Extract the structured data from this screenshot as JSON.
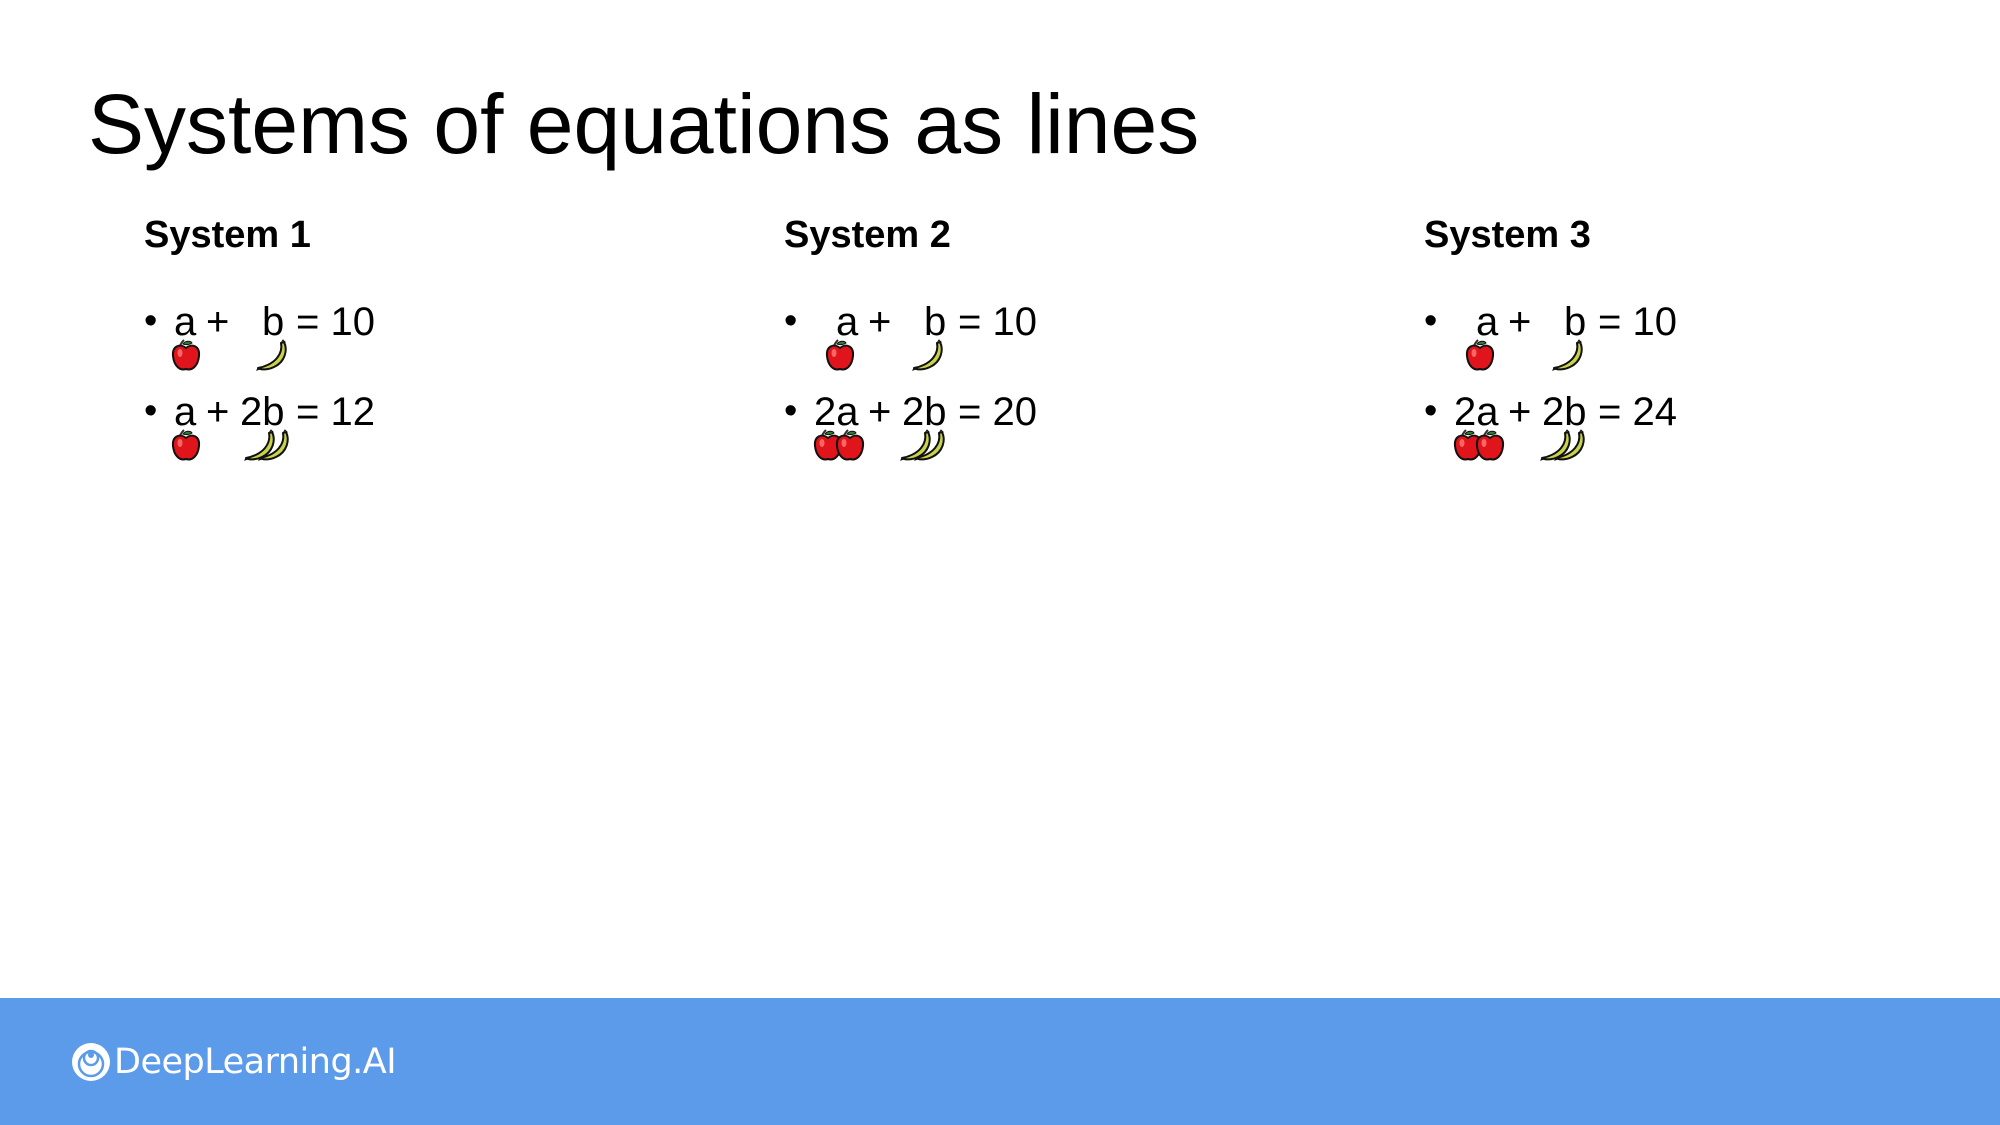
{
  "slide": {
    "title": "Systems of equations as lines"
  },
  "systems": [
    {
      "title": "System 1",
      "equations": [
        {
          "bullet": "•",
          "apple_coef": "",
          "plus": "+",
          "banana_coef": "",
          "rhs": "= 10",
          "apples": 1,
          "bananas": 1
        },
        {
          "bullet": "•",
          "apple_coef": "",
          "plus": "+",
          "banana_coef": "2",
          "rhs": "= 12",
          "apples": 1,
          "bananas": 2
        }
      ]
    },
    {
      "title": "System 2",
      "equations": [
        {
          "bullet": "•",
          "apple_coef": "",
          "plus": "+",
          "banana_coef": "",
          "rhs": "= 10",
          "apples": 1,
          "bananas": 1
        },
        {
          "bullet": "•",
          "apple_coef": "2",
          "plus": "+",
          "banana_coef": "2",
          "rhs": "= 20",
          "apples": 2,
          "bananas": 2
        }
      ]
    },
    {
      "title": "System 3",
      "equations": [
        {
          "bullet": "•",
          "apple_coef": "",
          "plus": "+",
          "banana_coef": "",
          "rhs": "= 10",
          "apples": 1,
          "bananas": 1
        },
        {
          "bullet": "•",
          "apple_coef": "2",
          "plus": "+",
          "banana_coef": "2",
          "rhs": "= 24",
          "apples": 2,
          "bananas": 2
        }
      ]
    }
  ],
  "variables": {
    "apple": "a",
    "banana": "b"
  },
  "icons": {
    "apple": "apple-icon",
    "banana": "banana-icon",
    "logo": "deeplearning-ai-logo-icon"
  },
  "colors": {
    "footer": "#5b9bea",
    "apple": "#e0141b",
    "banana": "#c9d34a"
  },
  "footer": {
    "brand": "DeepLearning.AI"
  }
}
